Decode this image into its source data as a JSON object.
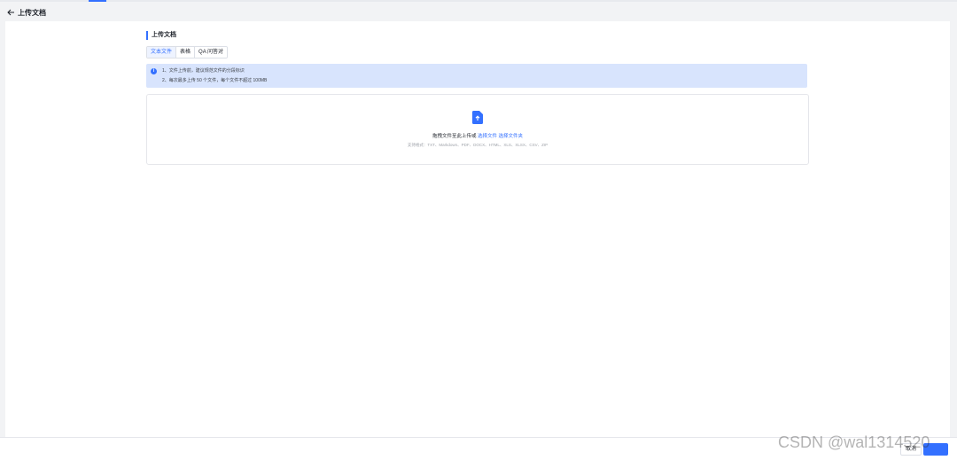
{
  "header": {
    "title": "上传文档",
    "back_icon": "arrow-left-icon"
  },
  "section": {
    "title": "上传文档"
  },
  "tabs": [
    {
      "label": "文本文件",
      "active": true
    },
    {
      "label": "表格",
      "active": false
    },
    {
      "label": "QA 问答对",
      "active": false
    }
  ],
  "notice": {
    "icon": "info-icon",
    "line1": "1、文件上传前，建议规范文件的分段标识",
    "line2": "2、每次最多上传 50 个文件，每个文件不超过 100MB"
  },
  "dropzone": {
    "icon": "file-upload-icon",
    "prefix": "拖拽文件至此上传或",
    "select_file": "选择文件",
    "select_folder": "选择文件夹",
    "formats": "支持格式：TXT、Markdown、PDF、DOCX、HTML、XLS、XLSX、CSV、ZIP"
  },
  "footer": {
    "cancel_label": "取消"
  },
  "watermark": "CSDN @wal1314520",
  "colors": {
    "accent": "#3370ff",
    "notice_bg": "#d8e4fd"
  }
}
